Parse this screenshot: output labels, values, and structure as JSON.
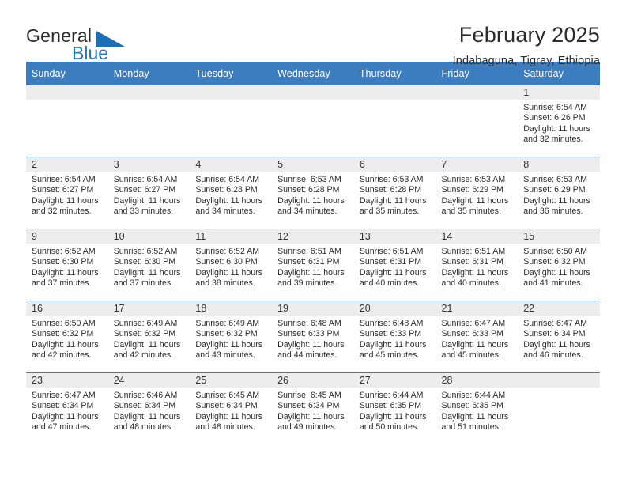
{
  "brand": {
    "word_one": "General",
    "word_two": "Blue",
    "triangle_icon": "blue-triangle-logo-icon",
    "accent_color": "#1b6fb5"
  },
  "header": {
    "title": "February 2025",
    "subtitle": "Indabaguna, Tigray, Ethiopia"
  },
  "theme": {
    "header_blue": "#3b7dbf",
    "daynum_band": "#ededed",
    "text": "#2d2d2d"
  },
  "weekday_headers": [
    "Sunday",
    "Monday",
    "Tuesday",
    "Wednesday",
    "Thursday",
    "Friday",
    "Saturday"
  ],
  "labels": {
    "sunrise_prefix": "Sunrise:",
    "sunset_prefix": "Sunset:",
    "daylight_prefix": "Daylight:"
  },
  "weeks": [
    [
      {
        "day": "",
        "empty": true
      },
      {
        "day": "",
        "empty": true
      },
      {
        "day": "",
        "empty": true
      },
      {
        "day": "",
        "empty": true
      },
      {
        "day": "",
        "empty": true
      },
      {
        "day": "",
        "empty": true
      },
      {
        "day": "1",
        "sunrise": "Sunrise: 6:54 AM",
        "sunset": "Sunset: 6:26 PM",
        "daylight": "Daylight: 11 hours and 32 minutes."
      }
    ],
    [
      {
        "day": "2",
        "sunrise": "Sunrise: 6:54 AM",
        "sunset": "Sunset: 6:27 PM",
        "daylight": "Daylight: 11 hours and 32 minutes."
      },
      {
        "day": "3",
        "sunrise": "Sunrise: 6:54 AM",
        "sunset": "Sunset: 6:27 PM",
        "daylight": "Daylight: 11 hours and 33 minutes."
      },
      {
        "day": "4",
        "sunrise": "Sunrise: 6:54 AM",
        "sunset": "Sunset: 6:28 PM",
        "daylight": "Daylight: 11 hours and 34 minutes."
      },
      {
        "day": "5",
        "sunrise": "Sunrise: 6:53 AM",
        "sunset": "Sunset: 6:28 PM",
        "daylight": "Daylight: 11 hours and 34 minutes."
      },
      {
        "day": "6",
        "sunrise": "Sunrise: 6:53 AM",
        "sunset": "Sunset: 6:28 PM",
        "daylight": "Daylight: 11 hours and 35 minutes."
      },
      {
        "day": "7",
        "sunrise": "Sunrise: 6:53 AM",
        "sunset": "Sunset: 6:29 PM",
        "daylight": "Daylight: 11 hours and 35 minutes."
      },
      {
        "day": "8",
        "sunrise": "Sunrise: 6:53 AM",
        "sunset": "Sunset: 6:29 PM",
        "daylight": "Daylight: 11 hours and 36 minutes."
      }
    ],
    [
      {
        "day": "9",
        "sunrise": "Sunrise: 6:52 AM",
        "sunset": "Sunset: 6:30 PM",
        "daylight": "Daylight: 11 hours and 37 minutes."
      },
      {
        "day": "10",
        "sunrise": "Sunrise: 6:52 AM",
        "sunset": "Sunset: 6:30 PM",
        "daylight": "Daylight: 11 hours and 37 minutes."
      },
      {
        "day": "11",
        "sunrise": "Sunrise: 6:52 AM",
        "sunset": "Sunset: 6:30 PM",
        "daylight": "Daylight: 11 hours and 38 minutes."
      },
      {
        "day": "12",
        "sunrise": "Sunrise: 6:51 AM",
        "sunset": "Sunset: 6:31 PM",
        "daylight": "Daylight: 11 hours and 39 minutes."
      },
      {
        "day": "13",
        "sunrise": "Sunrise: 6:51 AM",
        "sunset": "Sunset: 6:31 PM",
        "daylight": "Daylight: 11 hours and 40 minutes."
      },
      {
        "day": "14",
        "sunrise": "Sunrise: 6:51 AM",
        "sunset": "Sunset: 6:31 PM",
        "daylight": "Daylight: 11 hours and 40 minutes."
      },
      {
        "day": "15",
        "sunrise": "Sunrise: 6:50 AM",
        "sunset": "Sunset: 6:32 PM",
        "daylight": "Daylight: 11 hours and 41 minutes."
      }
    ],
    [
      {
        "day": "16",
        "sunrise": "Sunrise: 6:50 AM",
        "sunset": "Sunset: 6:32 PM",
        "daylight": "Daylight: 11 hours and 42 minutes."
      },
      {
        "day": "17",
        "sunrise": "Sunrise: 6:49 AM",
        "sunset": "Sunset: 6:32 PM",
        "daylight": "Daylight: 11 hours and 42 minutes."
      },
      {
        "day": "18",
        "sunrise": "Sunrise: 6:49 AM",
        "sunset": "Sunset: 6:32 PM",
        "daylight": "Daylight: 11 hours and 43 minutes."
      },
      {
        "day": "19",
        "sunrise": "Sunrise: 6:48 AM",
        "sunset": "Sunset: 6:33 PM",
        "daylight": "Daylight: 11 hours and 44 minutes."
      },
      {
        "day": "20",
        "sunrise": "Sunrise: 6:48 AM",
        "sunset": "Sunset: 6:33 PM",
        "daylight": "Daylight: 11 hours and 45 minutes."
      },
      {
        "day": "21",
        "sunrise": "Sunrise: 6:47 AM",
        "sunset": "Sunset: 6:33 PM",
        "daylight": "Daylight: 11 hours and 45 minutes."
      },
      {
        "day": "22",
        "sunrise": "Sunrise: 6:47 AM",
        "sunset": "Sunset: 6:34 PM",
        "daylight": "Daylight: 11 hours and 46 minutes."
      }
    ],
    [
      {
        "day": "23",
        "sunrise": "Sunrise: 6:47 AM",
        "sunset": "Sunset: 6:34 PM",
        "daylight": "Daylight: 11 hours and 47 minutes."
      },
      {
        "day": "24",
        "sunrise": "Sunrise: 6:46 AM",
        "sunset": "Sunset: 6:34 PM",
        "daylight": "Daylight: 11 hours and 48 minutes."
      },
      {
        "day": "25",
        "sunrise": "Sunrise: 6:45 AM",
        "sunset": "Sunset: 6:34 PM",
        "daylight": "Daylight: 11 hours and 48 minutes."
      },
      {
        "day": "26",
        "sunrise": "Sunrise: 6:45 AM",
        "sunset": "Sunset: 6:34 PM",
        "daylight": "Daylight: 11 hours and 49 minutes."
      },
      {
        "day": "27",
        "sunrise": "Sunrise: 6:44 AM",
        "sunset": "Sunset: 6:35 PM",
        "daylight": "Daylight: 11 hours and 50 minutes."
      },
      {
        "day": "28",
        "sunrise": "Sunrise: 6:44 AM",
        "sunset": "Sunset: 6:35 PM",
        "daylight": "Daylight: 11 hours and 51 minutes."
      },
      {
        "day": "",
        "empty": true
      }
    ]
  ]
}
